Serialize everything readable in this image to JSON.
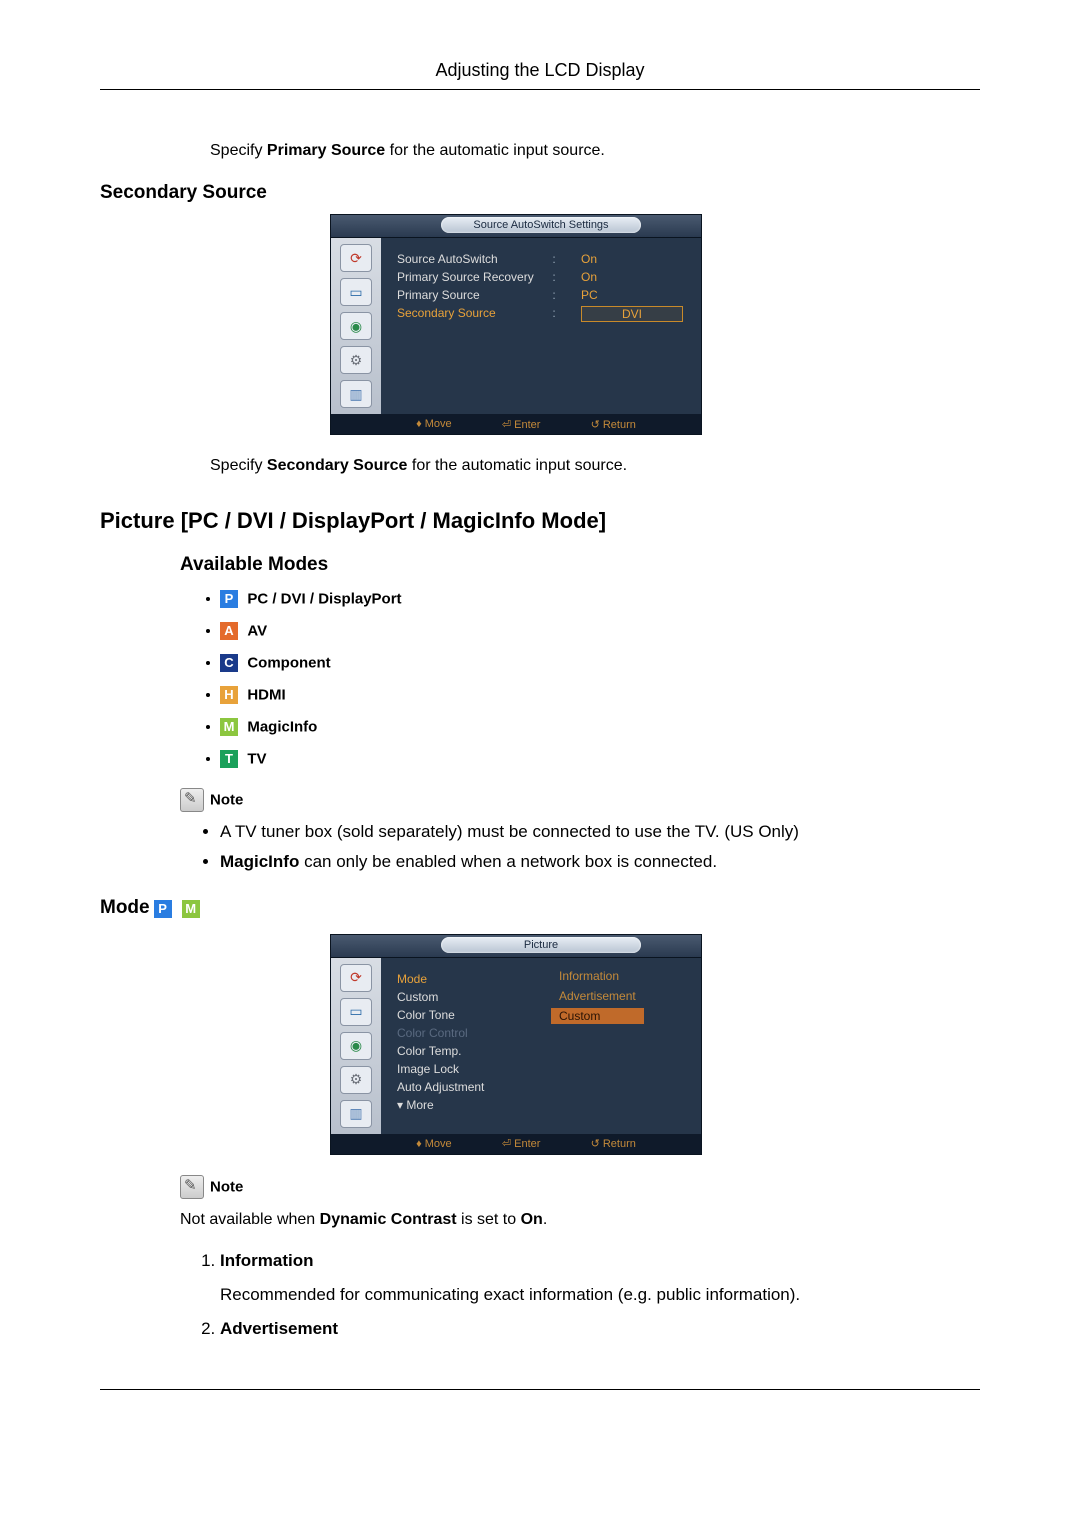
{
  "header": {
    "title": "Adjusting the LCD Display"
  },
  "intro": {
    "text_pre": "Specify ",
    "text_bold": "Primary Source",
    "text_post": " for the automatic input source."
  },
  "secondary": {
    "heading": "Secondary Source",
    "text_pre": "Specify ",
    "text_bold": "Secondary Source",
    "text_post": " for the automatic input source."
  },
  "osd1": {
    "title": "Source AutoSwitch Settings",
    "rows": [
      {
        "k": "Source AutoSwitch",
        "v": "On"
      },
      {
        "k": "Primary Source Recovery",
        "v": "On"
      },
      {
        "k": "Primary Source",
        "v": "PC"
      }
    ],
    "sel": {
      "k": "Secondary Source",
      "v": "DVI"
    },
    "footer": {
      "move": "Move",
      "enter": "Enter",
      "return": "Return"
    }
  },
  "picture": {
    "heading": "Picture [PC / DVI / DisplayPort / MagicInfo Mode]",
    "available": "Available Modes",
    "modes": [
      {
        "badge": "P",
        "cls": "b-p",
        "label": "PC / DVI / DisplayPort"
      },
      {
        "badge": "A",
        "cls": "b-a",
        "label": "AV"
      },
      {
        "badge": "C",
        "cls": "b-c",
        "label": "Component"
      },
      {
        "badge": "H",
        "cls": "b-h",
        "label": "HDMI"
      },
      {
        "badge": "M",
        "cls": "b-m",
        "label": "MagicInfo"
      },
      {
        "badge": "T",
        "cls": "b-t",
        "label": "TV"
      }
    ]
  },
  "note1": {
    "label": "Note",
    "items": [
      {
        "pre": "A TV tuner box (sold separately) must be connected to use the TV. (US Only)",
        "bold": "",
        "post": ""
      },
      {
        "pre": "",
        "bold": "MagicInfo",
        "post": " can only be enabled when a network box is connected."
      }
    ]
  },
  "mode": {
    "heading": "Mode",
    "badges": [
      "P",
      "M"
    ]
  },
  "osd2": {
    "title": "Picture",
    "left": [
      "Mode",
      "Custom",
      "Color Tone",
      "Color Control",
      "Color Temp.",
      "Image Lock",
      "Auto Adjustment",
      "▾ More"
    ],
    "dim_index": 3,
    "opts": [
      "Information",
      "Advertisement",
      "Custom"
    ],
    "hl_index": 2,
    "footer": {
      "move": "Move",
      "enter": "Enter",
      "return": "Return"
    }
  },
  "note2": {
    "label": "Note",
    "text_pre": "Not available when ",
    "text_bold": "Dynamic Contrast",
    "text_mid": " is set to ",
    "text_bold2": "On",
    "text_post": "."
  },
  "list": [
    {
      "title": "Information",
      "body": "Recommended for communicating exact information (e.g. public information)."
    },
    {
      "title": "Advertisement",
      "body": ""
    }
  ]
}
